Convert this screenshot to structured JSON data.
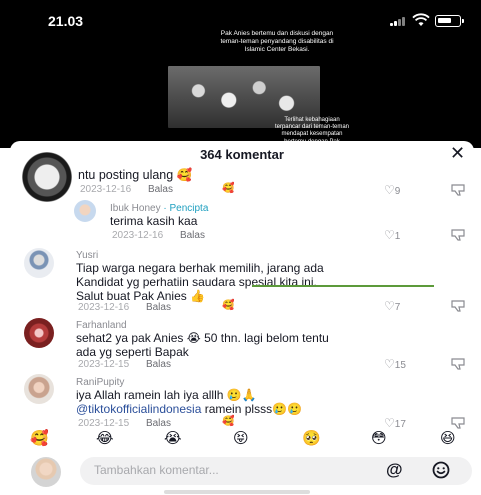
{
  "status_bar": {
    "time": "21.03"
  },
  "video": {
    "caption": "Pak Anies bertemu dan diskusi dengan teman-teman penyandang disabilitas di Islamic Center Bekasi.",
    "subcaption": "Terlihat kebahagiaan terpancar dari teman-teman mendapat kesempatan bertemu dengan Pak"
  },
  "sheet": {
    "title": "364 komentar",
    "close_icon": "close-icon"
  },
  "comments": [
    {
      "username": "",
      "text": "ntu posting ulang 🥰",
      "date": "2023-12-16",
      "reply": "Balas",
      "likes": "9"
    },
    {
      "username": "Ibuk Honey",
      "badge": "· Pencipta",
      "text": "terima kasih kaa",
      "date": "2023-12-16",
      "reply": "Balas",
      "likes": "1"
    },
    {
      "username": "Yusri",
      "text_lines": [
        "Tiap warga negara berhak memilih, jarang ada",
        "Kandidat yg perhatiin saudara spesial kita ini.",
        "Salut buat Pak Anies 👍"
      ],
      "date": "2023-12-16",
      "reply": "Balas",
      "likes": "7"
    },
    {
      "username": "Farhanland",
      "text_lines": [
        "sehat2 ya pak Anies 😭 50 thn. lagi belom tentu",
        "ada yg seperti Bapak"
      ],
      "date": "2023-12-15",
      "reply": "Balas",
      "likes": "15"
    },
    {
      "username": "RaniPupity",
      "text_lines": [
        "iya Allah ramein lah iya alllh 🥲🙏",
        "@tiktokofficialindonesia",
        "ramein plsss🥲🥲"
      ],
      "date": "2023-12-15",
      "reply": "Balas",
      "likes": "17"
    }
  ],
  "emoji_bar": [
    "🥰",
    "😂",
    "😭",
    "😝",
    "🥺",
    "😳",
    "😆"
  ],
  "input": {
    "placeholder": "Tambahkan komentar..."
  }
}
